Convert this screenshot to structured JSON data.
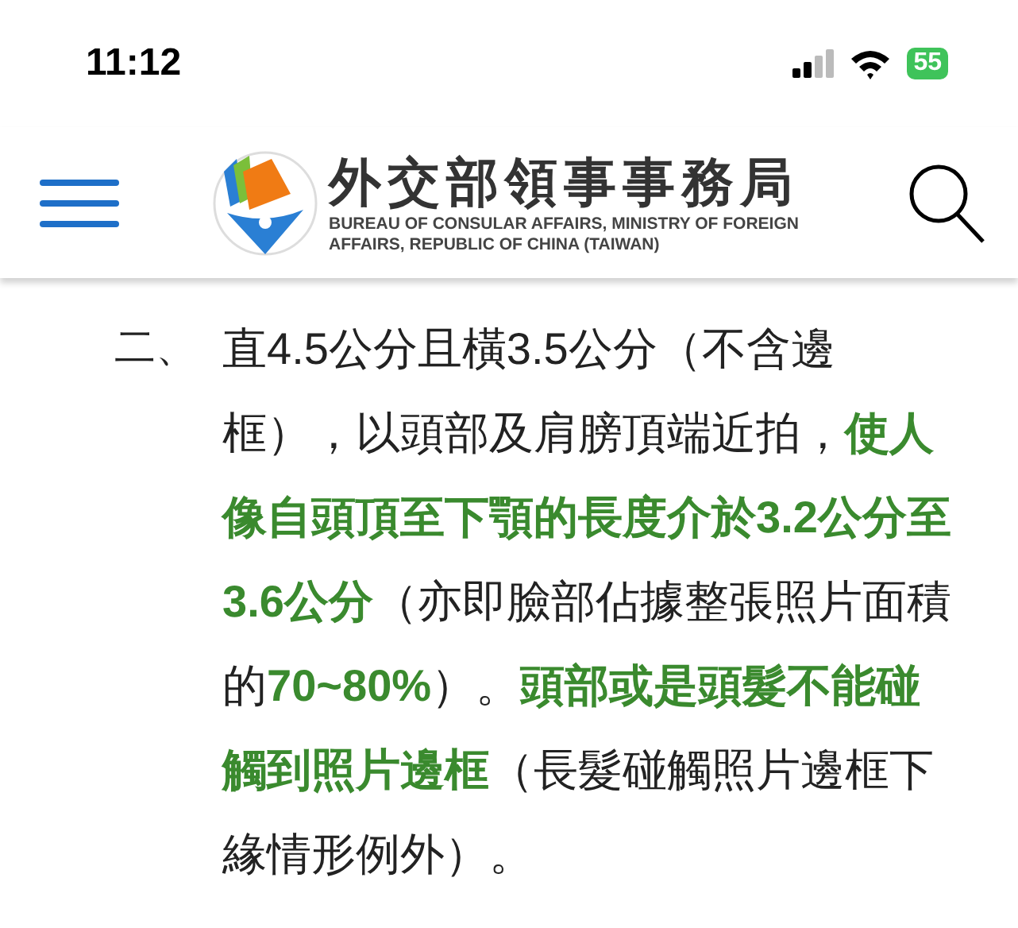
{
  "status_bar": {
    "time": "11:12",
    "battery": "55"
  },
  "header": {
    "title": "外交部領事事務局",
    "subtitle_lines": [
      "BUREAU OF CONSULAR AFFAIRS, MINISTRY OF FOREIGN",
      "AFFAIRS, REPUBLIC OF CHINA (TAIWAN)"
    ]
  },
  "item": {
    "marker": "二、",
    "text": "直4.5公分且橫3.5公分（不含邊框），以頭部及肩膀頂端近拍，**使人像自頭頂至下顎的長度介於3.2公分至3.6公分**（亦即臉部佔據整張照片面積的**70~80%**）。**頭部或是頭髮不能碰觸到照片邊框**（長髮碰觸照片邊框下緣情形例外）。"
  }
}
